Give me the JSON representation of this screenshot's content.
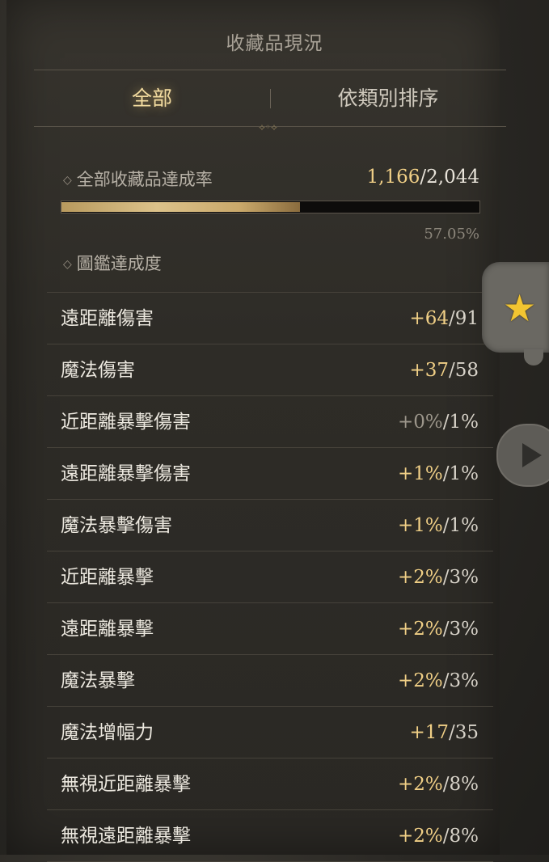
{
  "title": "收藏品現況",
  "tabs": {
    "all": "全部",
    "by_category": "依類別排序"
  },
  "completion": {
    "label": "全部收藏品達成率",
    "current": "1,166",
    "total": "/2,044",
    "percent_text": "57.05%",
    "progress": 0.5705
  },
  "codex_label": "圖鑑達成度",
  "stats": [
    {
      "name": "遠距離傷害",
      "current": "+64",
      "max": "/91"
    },
    {
      "name": "魔法傷害",
      "current": "+37",
      "max": "/58"
    },
    {
      "name": "近距離暴擊傷害",
      "current": "+0%",
      "max": "/1%"
    },
    {
      "name": "遠距離暴擊傷害",
      "current": "+1%",
      "max": "/1%"
    },
    {
      "name": "魔法暴擊傷害",
      "current": "+1%",
      "max": "/1%"
    },
    {
      "name": "近距離暴擊",
      "current": "+2%",
      "max": "/3%"
    },
    {
      "name": "遠距離暴擊",
      "current": "+2%",
      "max": "/3%"
    },
    {
      "name": "魔法暴擊",
      "current": "+2%",
      "max": "/3%"
    },
    {
      "name": "魔法增幅力",
      "current": "+17",
      "max": "/35"
    },
    {
      "name": "無視近距離暴擊",
      "current": "+2%",
      "max": "/8%"
    },
    {
      "name": "無視遠距離暴擊",
      "current": "+2%",
      "max": "/8%"
    }
  ],
  "icons": {
    "side_tab": "star-icon",
    "next": "play-icon"
  },
  "colors": {
    "accent_gold": "#f0cf86",
    "star": "#f2c531"
  }
}
